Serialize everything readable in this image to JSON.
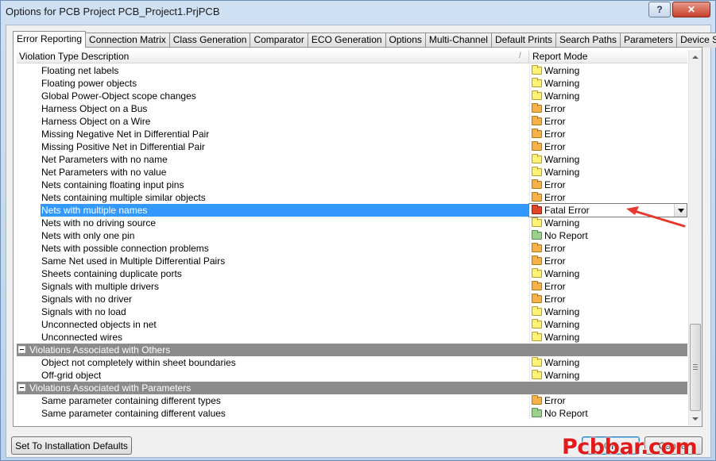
{
  "window": {
    "title": "Options for PCB Project PCB_Project1.PrjPCB",
    "help_label": "?",
    "close_label": "✕"
  },
  "tabs": [
    {
      "label": "Error Reporting",
      "active": true
    },
    {
      "label": "Connection Matrix"
    },
    {
      "label": "Class Generation"
    },
    {
      "label": "Comparator"
    },
    {
      "label": "ECO Generation"
    },
    {
      "label": "Options"
    },
    {
      "label": "Multi-Channel"
    },
    {
      "label": "Default Prints"
    },
    {
      "label": "Search Paths"
    },
    {
      "label": "Parameters"
    },
    {
      "label": "Device Sheets"
    }
  ],
  "grid": {
    "col_description": "Violation Type Description",
    "col_mode": "Report Mode",
    "rows": [
      {
        "desc": "Floating net labels",
        "mode": "Warning"
      },
      {
        "desc": "Floating power objects",
        "mode": "Warning"
      },
      {
        "desc": "Global Power-Object scope changes",
        "mode": "Warning"
      },
      {
        "desc": "Harness Object on a Bus",
        "mode": "Error"
      },
      {
        "desc": "Harness Object on a Wire",
        "mode": "Error"
      },
      {
        "desc": "Missing Negative Net in Differential Pair",
        "mode": "Error"
      },
      {
        "desc": "Missing Positive Net in Differential Pair",
        "mode": "Error"
      },
      {
        "desc": "Net Parameters with no name",
        "mode": "Warning"
      },
      {
        "desc": "Net Parameters with no value",
        "mode": "Warning"
      },
      {
        "desc": "Nets containing floating input pins",
        "mode": "Error"
      },
      {
        "desc": "Nets containing multiple similar objects",
        "mode": "Error"
      },
      {
        "desc": "Nets with multiple names",
        "mode": "Fatal Error",
        "selected": true
      },
      {
        "desc": "Nets with no driving source",
        "mode": "Warning"
      },
      {
        "desc": "Nets with only one pin",
        "mode": "No Report"
      },
      {
        "desc": "Nets with possible connection problems",
        "mode": "Error"
      },
      {
        "desc": "Same Net used in Multiple Differential Pairs",
        "mode": "Error"
      },
      {
        "desc": "Sheets containing duplicate ports",
        "mode": "Warning"
      },
      {
        "desc": "Signals with multiple drivers",
        "mode": "Error"
      },
      {
        "desc": "Signals with no driver",
        "mode": "Error"
      },
      {
        "desc": "Signals with no load",
        "mode": "Warning"
      },
      {
        "desc": "Unconnected objects in net",
        "mode": "Warning"
      },
      {
        "desc": "Unconnected wires",
        "mode": "Warning"
      },
      {
        "group": "Violations Associated with Others"
      },
      {
        "desc": "Object not completely within sheet boundaries",
        "mode": "Warning"
      },
      {
        "desc": "Off-grid object",
        "mode": "Warning"
      },
      {
        "group": "Violations Associated with Parameters"
      },
      {
        "desc": "Same parameter containing different types",
        "mode": "Error"
      },
      {
        "desc": "Same parameter containing different values",
        "mode": "No Report"
      }
    ]
  },
  "buttons": {
    "defaults": "Set To Installation Defaults",
    "ok": "OK",
    "cancel": "Cancel"
  },
  "watermark": "Pcbbar.com",
  "colors": {
    "selection": "#3399ff",
    "group_header": "#8b8b8b",
    "annotation_arrow": "#e8372c",
    "watermark": "#e21a1a"
  }
}
